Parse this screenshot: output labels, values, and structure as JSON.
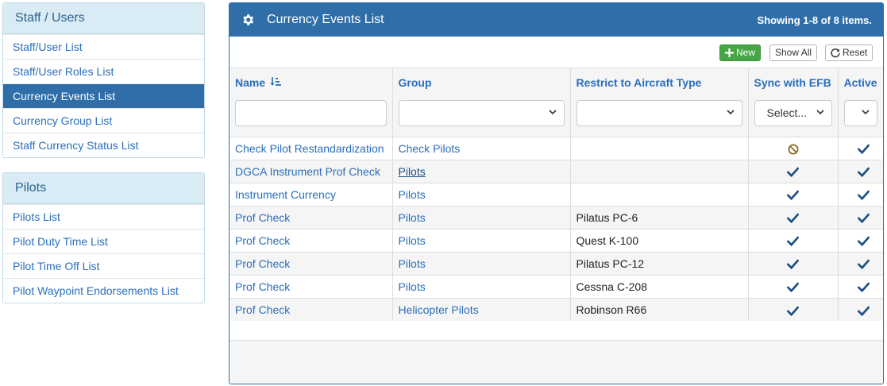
{
  "sidebar": {
    "staff": {
      "title": "Staff / Users",
      "items": [
        {
          "label": "Staff/User List"
        },
        {
          "label": "Staff/User Roles List"
        },
        {
          "label": "Currency Events List"
        },
        {
          "label": "Currency Group List"
        },
        {
          "label": "Staff Currency Status List"
        }
      ]
    },
    "pilots": {
      "title": "Pilots",
      "items": [
        {
          "label": "Pilots List"
        },
        {
          "label": "Pilot Duty Time List"
        },
        {
          "label": "Pilot Time Off List"
        },
        {
          "label": "Pilot Waypoint Endorsements List"
        }
      ]
    }
  },
  "panel": {
    "title": "Currency Events List",
    "summary": "Showing 1-8 of 8 items.",
    "icon": "gear-icon"
  },
  "toolbar": {
    "new_label": "New",
    "show_all_label": "Show All",
    "reset_label": "Reset"
  },
  "table": {
    "columns": {
      "name": "Name",
      "group": "Group",
      "aircraft": "Restrict to Aircraft Type",
      "sync": "Sync with EFB",
      "active": "Active"
    },
    "filters": {
      "sync_placeholder": "Select..."
    },
    "rows": [
      {
        "name": "Check Pilot Restandardization",
        "group": "Check Pilots",
        "aircraft": "",
        "sync": "ban-icon",
        "active": "check-icon"
      },
      {
        "name": "DGCA Instrument Prof Check",
        "group": "Pilots",
        "aircraft": "",
        "sync": "check-icon",
        "active": "check-icon"
      },
      {
        "name": "Instrument Currency",
        "group": "Pilots",
        "aircraft": "",
        "sync": "check-icon",
        "active": "check-icon"
      },
      {
        "name": "Prof Check",
        "group": "Pilots",
        "aircraft": "Pilatus PC-6",
        "sync": "check-icon",
        "active": "check-icon"
      },
      {
        "name": "Prof Check",
        "group": "Pilots",
        "aircraft": "Quest K-100",
        "sync": "check-icon",
        "active": "check-icon"
      },
      {
        "name": "Prof Check",
        "group": "Pilots",
        "aircraft": "Pilatus PC-12",
        "sync": "check-icon",
        "active": "check-icon"
      },
      {
        "name": "Prof Check",
        "group": "Pilots",
        "aircraft": "Cessna C-208",
        "sync": "check-icon",
        "active": "check-icon"
      },
      {
        "name": "Prof Check",
        "group": "Helicopter Pilots",
        "aircraft": "Robinson R66",
        "sync": "check-icon",
        "active": "check-icon"
      }
    ]
  },
  "colors": {
    "primary": "#2f6ea8",
    "link": "#2a6ebb",
    "success": "#46a546",
    "sidebar_heading_bg": "#d9ecf5",
    "ban_icon": "#8b6a2b",
    "check_icon": "#1d4f80"
  }
}
